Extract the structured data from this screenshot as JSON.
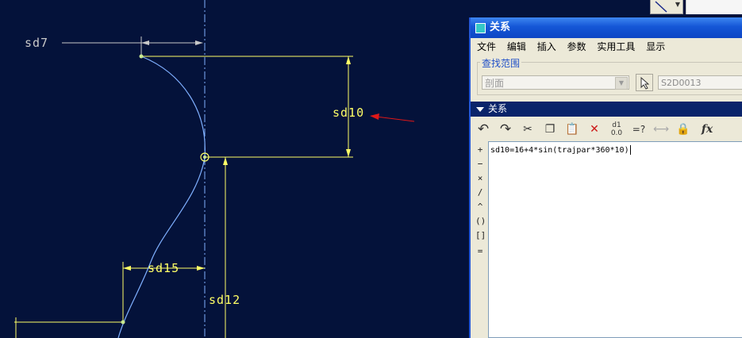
{
  "sketch": {
    "dimensions": {
      "sd7": "sd7",
      "sd10": "sd10",
      "sd15": "sd15",
      "sd12": "sd12"
    },
    "colors": {
      "background": "#04123a",
      "dimension": "#ffff66",
      "curve": "#7fb0ff",
      "arrow": "#e01818"
    }
  },
  "dialog": {
    "title": "关系",
    "menu": [
      "文件",
      "编辑",
      "插入",
      "参数",
      "实用工具",
      "显示"
    ],
    "search_scope": {
      "label": "查找范围",
      "selected": "剖面",
      "scope_value": "S2D0013"
    },
    "section_title": "关系",
    "toolbar_icons": [
      "undo-icon",
      "redo-icon",
      "cut-icon",
      "copy-icon",
      "paste-icon",
      "delete-icon",
      "display-values-icon",
      "verify-icon",
      "sort-icon",
      "locals-icon",
      "function-icon"
    ],
    "operators": [
      "+",
      "−",
      "×",
      "/",
      "^",
      "()",
      "[]",
      "="
    ],
    "relation_text": "sd10=16+4*sin(trajpar*360*10)"
  }
}
